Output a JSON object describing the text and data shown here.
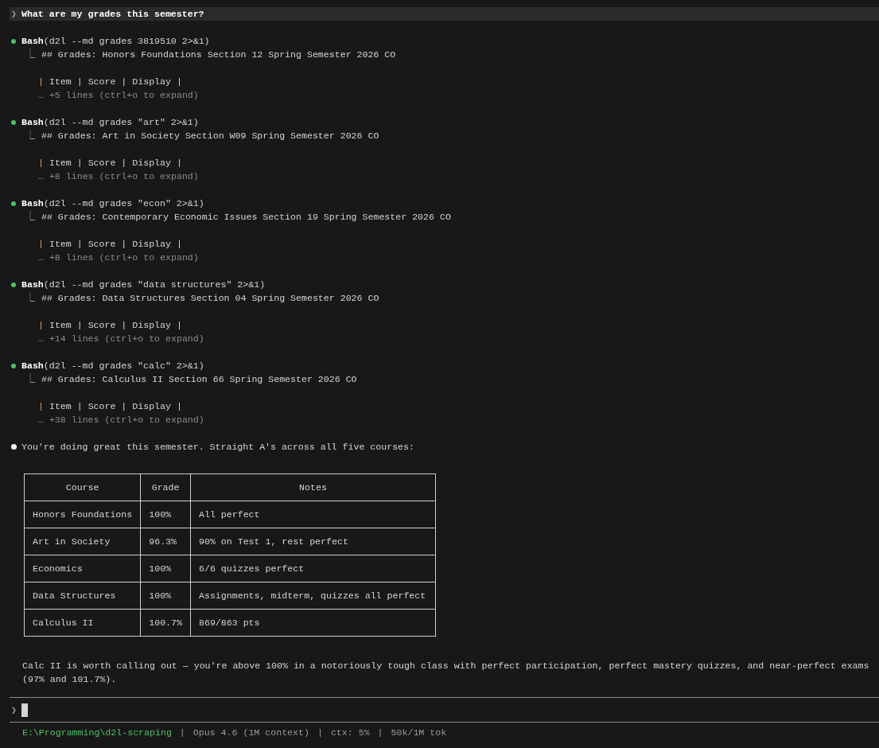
{
  "prompt": {
    "symbol": "❯",
    "text": "What are my grades this semester?"
  },
  "tool_calls": [
    {
      "color": "#4ec06a",
      "name": "Bash",
      "args": "(d2l --md grades 3819510 2>&1)",
      "connector": "⎿",
      "result": "## Grades: Honors Foundations Section 12 Spring Semester 2026 CO",
      "pipe_open": "|",
      "table_header": " Item | Score | Display |",
      "more": "… +5 lines (ctrl+o to expand)"
    },
    {
      "color": "#4ec06a",
      "name": "Bash",
      "args": "(d2l --md grades \"art\" 2>&1)",
      "connector": "⎿",
      "result": "## Grades: Art in Society Section W09 Spring Semester 2026 CO",
      "pipe_open": "|",
      "table_header": " Item | Score | Display |",
      "more": "… +8 lines (ctrl+o to expand)"
    },
    {
      "color": "#4ec06a",
      "name": "Bash",
      "args": "(d2l --md grades \"econ\" 2>&1)",
      "connector": "⎿",
      "result": "## Grades: Contemporary Economic Issues Section 19 Spring Semester 2026 CO",
      "pipe_open": "|",
      "table_header": " Item | Score | Display |",
      "more": "… +8 lines (ctrl+o to expand)"
    },
    {
      "color": "#4ec06a",
      "name": "Bash",
      "args": "(d2l --md grades \"data structures\" 2>&1)",
      "connector": "⎿",
      "result": "## Grades: Data Structures Section 04 Spring Semester 2026 CO",
      "pipe_open": "|",
      "table_header": " Item | Score | Display |",
      "more": "… +14 lines (ctrl+o to expand)"
    },
    {
      "color": "#4ec06a",
      "name": "Bash",
      "args": "(d2l --md grades \"calc\" 2>&1)",
      "connector": "⎿",
      "result": "## Grades: Calculus II Section 66 Spring Semester 2026 CO",
      "pipe_open": "|",
      "table_header": " Item | Score | Display |",
      "more": "… +38 lines (ctrl+o to expand)"
    }
  ],
  "answer": {
    "intro": "You're doing great this semester. Straight A's across all five courses:",
    "table": {
      "columns": [
        "Course",
        "Grade",
        "Notes"
      ],
      "rows": [
        [
          "Honors Foundations",
          "100%",
          "All perfect"
        ],
        [
          "Art in Society",
          "96.3%",
          "90% on Test 1, rest perfect"
        ],
        [
          "Economics",
          "100%",
          "6/6 quizzes perfect"
        ],
        [
          "Data Structures",
          "100%",
          "Assignments, midterm, quizzes all perfect"
        ],
        [
          "Calculus II",
          "100.7%",
          "869/863 pts"
        ]
      ]
    },
    "summary": "Calc II is worth calling out — you're above 100% in a notoriously tough class with perfect participation, perfect mastery quizzes, and near-perfect exams (97% and 101.7%)."
  },
  "input": {
    "symbol": "❯"
  },
  "status_bar": [
    {
      "kind": "path",
      "text": "E:\\Programming\\d2l-scraping"
    },
    {
      "kind": "separator",
      "text": "|"
    },
    {
      "kind": "info",
      "text": "Opus 4.6 (1M context)"
    },
    {
      "kind": "separator",
      "text": "|"
    },
    {
      "kind": "info",
      "text": "ctx: 5%"
    },
    {
      "kind": "separator",
      "text": "|"
    },
    {
      "kind": "info",
      "text": "50k/1M tok"
    }
  ]
}
